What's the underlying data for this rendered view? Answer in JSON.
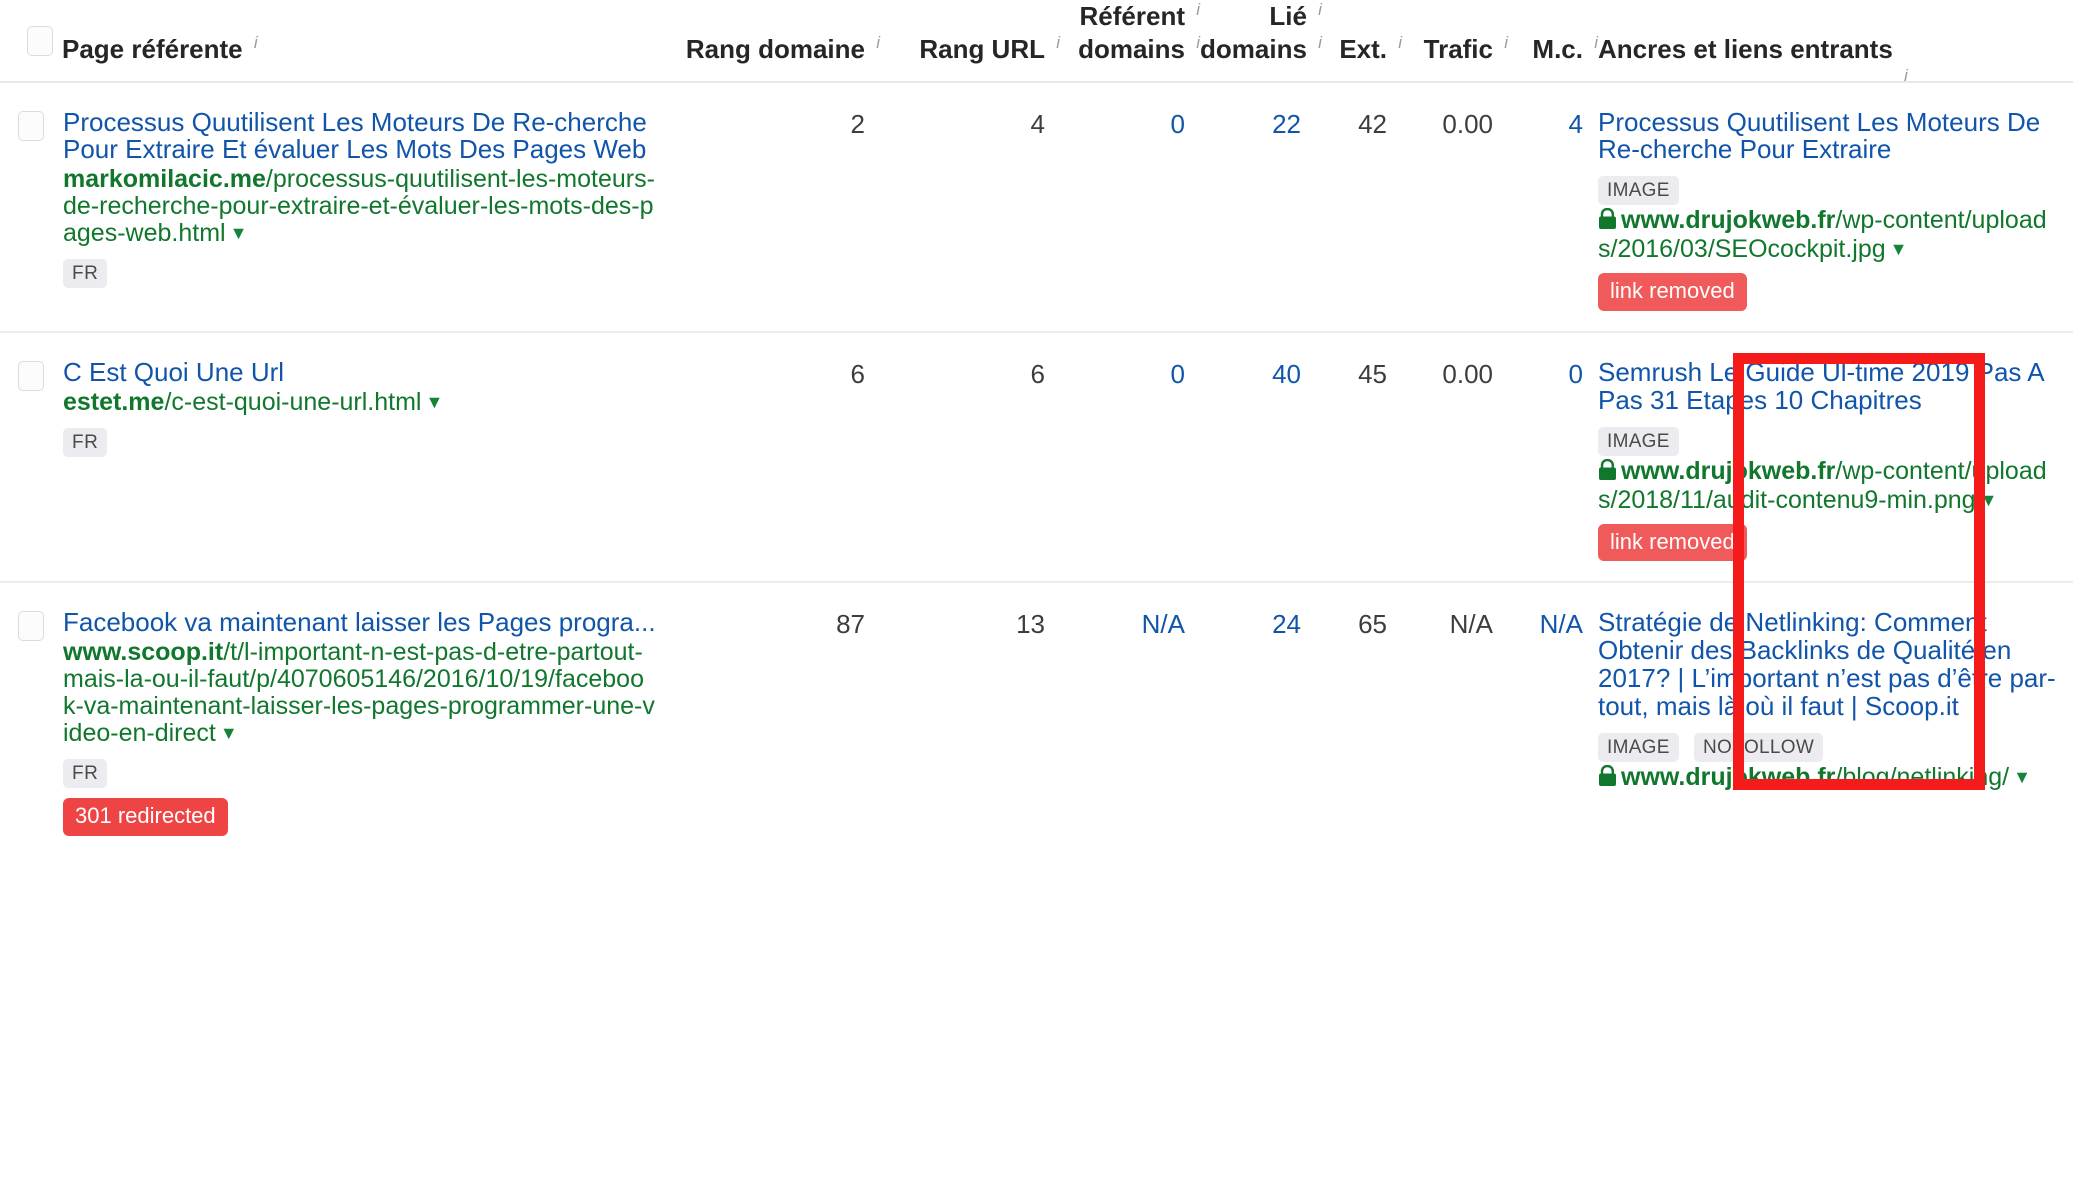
{
  "table": {
    "columns": [
      {
        "key": "checkbox",
        "label": "",
        "align": "left",
        "info": false
      },
      {
        "key": "page",
        "label": "Page référente",
        "align": "left",
        "info": true
      },
      {
        "key": "domain_rank",
        "label": "Rang domaine",
        "align": "right",
        "info": true
      },
      {
        "key": "url_rank",
        "label": "Rang URL",
        "align": "right",
        "info": true
      },
      {
        "key": "ref_domains",
        "label_line1": "Référent",
        "label_line2": "domains",
        "align": "right",
        "info": true
      },
      {
        "key": "linked_domains",
        "label_line1": "Lié",
        "label_line2": "domains",
        "align": "right",
        "info": true
      },
      {
        "key": "ext",
        "label": "Ext.",
        "align": "right",
        "info": true
      },
      {
        "key": "traffic",
        "label": "Trafic",
        "align": "right",
        "info": true
      },
      {
        "key": "keywords",
        "label": "M.c.",
        "align": "right",
        "info": true
      },
      {
        "key": "anchors",
        "label": "Ancres et liens entrants",
        "align": "left",
        "info": true
      }
    ],
    "rows": [
      {
        "checkbox_checked": false,
        "title": "Processus Quutilisent Les Moteurs De Re-cherche Pour Extraire Et évaluer Les Mots Des Pages Web",
        "url_domain": "markomilacic.me",
        "url_path": "/processus-quutilisent-les-moteurs-de-recherche-pour-extraire-et-évaluer-les-mots-des-pages-web.html",
        "url_caret": "▼",
        "tags": [
          "FR"
        ],
        "status_badge": "",
        "domain_rank": "2",
        "url_rank": "4",
        "ref_domains": "0",
        "linked_domains": "22",
        "ext": "42",
        "traffic": "0.00",
        "keywords": "4",
        "anchor_title": "Processus Quutilisent Les Moteurs De Re-cherche Pour Extraire",
        "anchor_tags": [
          "IMAGE"
        ],
        "anchor_domain": "www.drujokweb.fr",
        "anchor_path": "/wp-content/uploads/2016/03/SEOcockpit.jpg",
        "anchor_caret": "▼",
        "anchor_badge": "link removed"
      },
      {
        "checkbox_checked": false,
        "title": "C Est Quoi Une Url",
        "url_domain": "estet.me",
        "url_path": "/c-est-quoi-une-url.html",
        "url_caret": "▼",
        "tags": [
          "FR"
        ],
        "status_badge": "",
        "domain_rank": "6",
        "url_rank": "6",
        "ref_domains": "0",
        "linked_domains": "40",
        "ext": "45",
        "traffic": "0.00",
        "keywords": "0",
        "anchor_title": "Semrush Le Guide Ul-time 2019 Pas A Pas 31 Etapes 10 Chapitres",
        "anchor_tags": [
          "IMAGE"
        ],
        "anchor_domain": "www.drujokweb.fr",
        "anchor_path": "/wp-content/uploads/2018/11/audit-contenu9-min.png",
        "anchor_caret": "▼",
        "anchor_badge": "link removed"
      },
      {
        "checkbox_checked": false,
        "title": "Facebook va maintenant laisser les Pages progra...",
        "url_domain": "www.scoop.it",
        "url_path": "/t/l-important-n-est-pas-d-etre-partout-mais-la-ou-il-faut/p/4070605146/2016/10/19/facebook-va-maintenant-laisser-les-pages-programmer-une-video-en-direct",
        "url_caret": "▼",
        "tags": [
          "FR"
        ],
        "status_badge": "301 redirected",
        "domain_rank": "87",
        "url_rank": "13",
        "ref_domains": "N/A",
        "linked_domains": "24",
        "ext": "65",
        "traffic": "N/A",
        "keywords": "N/A",
        "anchor_title": "Stratégie de Netlinking: Comment Obtenir des Backlinks de Qualité en 2017? | L’important n’est pas d’être par-tout, mais là où il faut | Scoop.it",
        "anchor_tags": [
          "IMAGE",
          "NOFOLLOW"
        ],
        "anchor_domain": "www.drujokweb.fr",
        "anchor_path": "/blog/netlinking/",
        "anchor_caret": "▼",
        "anchor_badge": ""
      }
    ]
  },
  "annotation": {
    "type": "red-rectangle-highlight",
    "color": "#f51b1b"
  },
  "icons": {
    "info": "i",
    "lock": "lock-icon",
    "caret": "▼"
  },
  "colors": {
    "link": "#1155aa",
    "url_green": "#11772d",
    "badge_red": "#ef4444",
    "tag_bg": "#ececf0",
    "annotation_red": "#f51b1b"
  }
}
